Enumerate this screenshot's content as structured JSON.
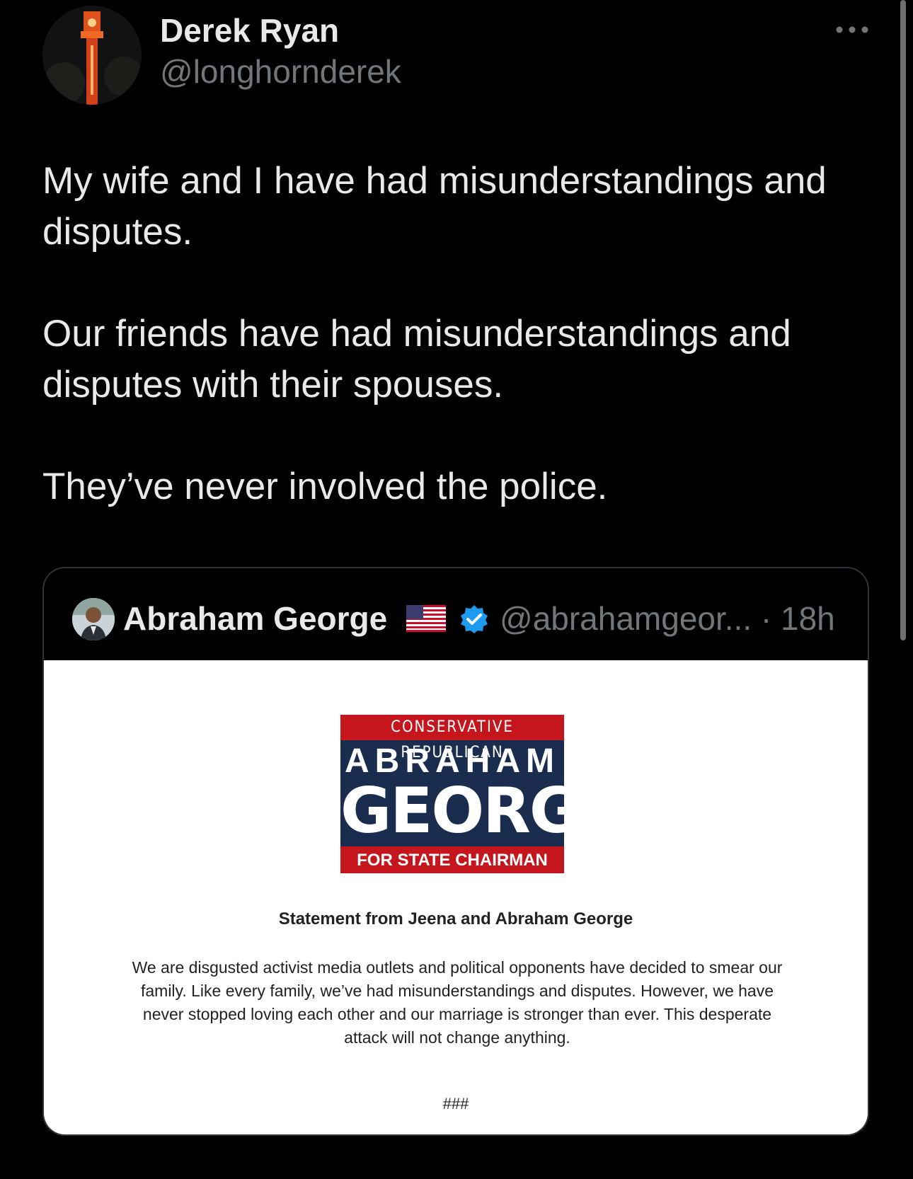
{
  "author": {
    "name": "Derek Ryan",
    "handle": "@longhornderek",
    "avatar_icon": "tower-avatar"
  },
  "tweet": {
    "paragraphs": [
      "My wife and I have had misunderstandings and disputes.",
      "Our friends have had misunderstandings and disputes with their spouses.",
      "They’ve never involved the police."
    ]
  },
  "quote": {
    "name": "Abraham George",
    "flag_icon": "us-flag-icon",
    "verified_icon": "verified-badge-icon",
    "handle_time": "@abrahamgeor... · 18h",
    "image": {
      "logo_top": "CONSERVATIVE REPUBLICAN",
      "logo_mid": "ABRAHAM",
      "logo_big": "GEORGE",
      "logo_bottom": "FOR STATE CHAIRMAN",
      "statement_title": "Statement from Jeena and Abraham George",
      "statement_body": "We are disgusted activist media outlets and political opponents have decided to smear our family. Like every family, we’ve had misunderstandings and disputes. However, we have never stopped loving each other and our marriage is stronger than ever. This desperate attack will not change anything.",
      "statement_end": "###"
    }
  },
  "colors": {
    "background": "#000000",
    "text": "#e7e9ea",
    "muted": "#71767b",
    "verified": "#1d9bf0",
    "logo_navy": "#1b2d4f",
    "logo_red": "#c4161c"
  }
}
